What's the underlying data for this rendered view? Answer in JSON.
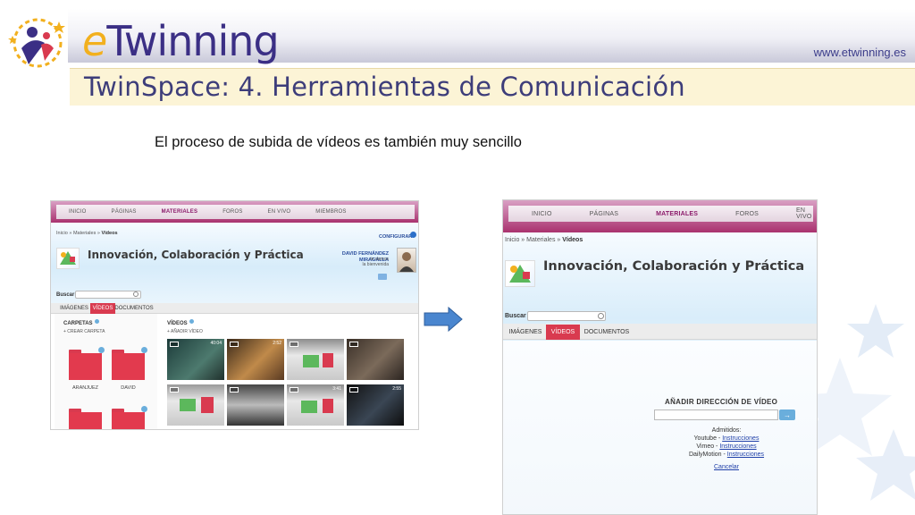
{
  "header": {
    "brand_prefix": "e",
    "brand_rest": "Twinning",
    "url": "www.etwinning.es",
    "slide_title": "TwinSpace: 4. Herramientas de Comunicación",
    "subtitle": "El proceso de subida de vídeos es también muy sencillo"
  },
  "colors": {
    "accent_red": "#d93a4f",
    "nav_purple": "#8b1a6a",
    "link_blue": "#1f3fa8",
    "arrow": "#4a86cf"
  },
  "screenshot1": {
    "nav": [
      "INICIO",
      "PÁGINAS",
      "MATERIALES",
      "FOROS",
      "EN VIVO",
      "MIEMBROS"
    ],
    "nav_active": "MATERIALES",
    "breadcrumb": [
      "Inicio",
      "»",
      "Materiales",
      "»",
      "Vídeos"
    ],
    "configure": "CONFIGURAR",
    "project_title": "Innovación, Colaboración y Práctica",
    "user_name": "DAVID FERNÁNDEZ MIRAGALLA",
    "user_greeting_1": ", te damos",
    "user_greeting_2": "la bienvenida",
    "search_label": "Buscar",
    "tabs": [
      "IMÁGENES",
      "VÍDEOS",
      "DOCUMENTOS"
    ],
    "folders_title": "CARPETAS",
    "create_folder": "+ CREAR CARPETA",
    "folders": [
      {
        "label": "ARANJUEZ",
        "count": "3"
      },
      {
        "label": "DAVID",
        "count": "6"
      },
      {
        "label": "",
        "count": ""
      },
      {
        "label": "",
        "count": "3"
      }
    ],
    "videos_title": "VÍDEOS",
    "add_video": "+ AÑADIR VÍDEO",
    "videos": [
      {
        "duration": "40:04"
      },
      {
        "duration": "2:52"
      },
      {
        "duration": ""
      },
      {
        "duration": ""
      },
      {
        "duration": ""
      },
      {
        "duration": ""
      },
      {
        "duration": "3:41"
      },
      {
        "duration": "2:55"
      }
    ]
  },
  "screenshot2": {
    "nav": [
      "INICIO",
      "PÁGINAS",
      "MATERIALES",
      "FOROS",
      "EN VIVO"
    ],
    "nav_active": "MATERIALES",
    "breadcrumb": [
      "Inicio",
      "»",
      "Materiales",
      "»",
      "Vídeos"
    ],
    "project_title": "Innovación, Colaboración y Práctica",
    "search_label": "Buscar",
    "tabs": [
      "IMÁGENES",
      "VÍDEOS",
      "DOCUMENTOS"
    ],
    "add_video_title": "AÑADIR DIRECCIÓN DE VÍDEO",
    "go_icon": "arrow-right-icon",
    "allowed_label": "Admitidos:",
    "providers": [
      {
        "name": "Youtube",
        "link": "Instrucciones"
      },
      {
        "name": "Vimeo",
        "link": "Instrucciones"
      },
      {
        "name": "DailyMotion",
        "link": "Instrucciones"
      }
    ],
    "provider_separator": " - ",
    "cancel": "Cancelar"
  }
}
